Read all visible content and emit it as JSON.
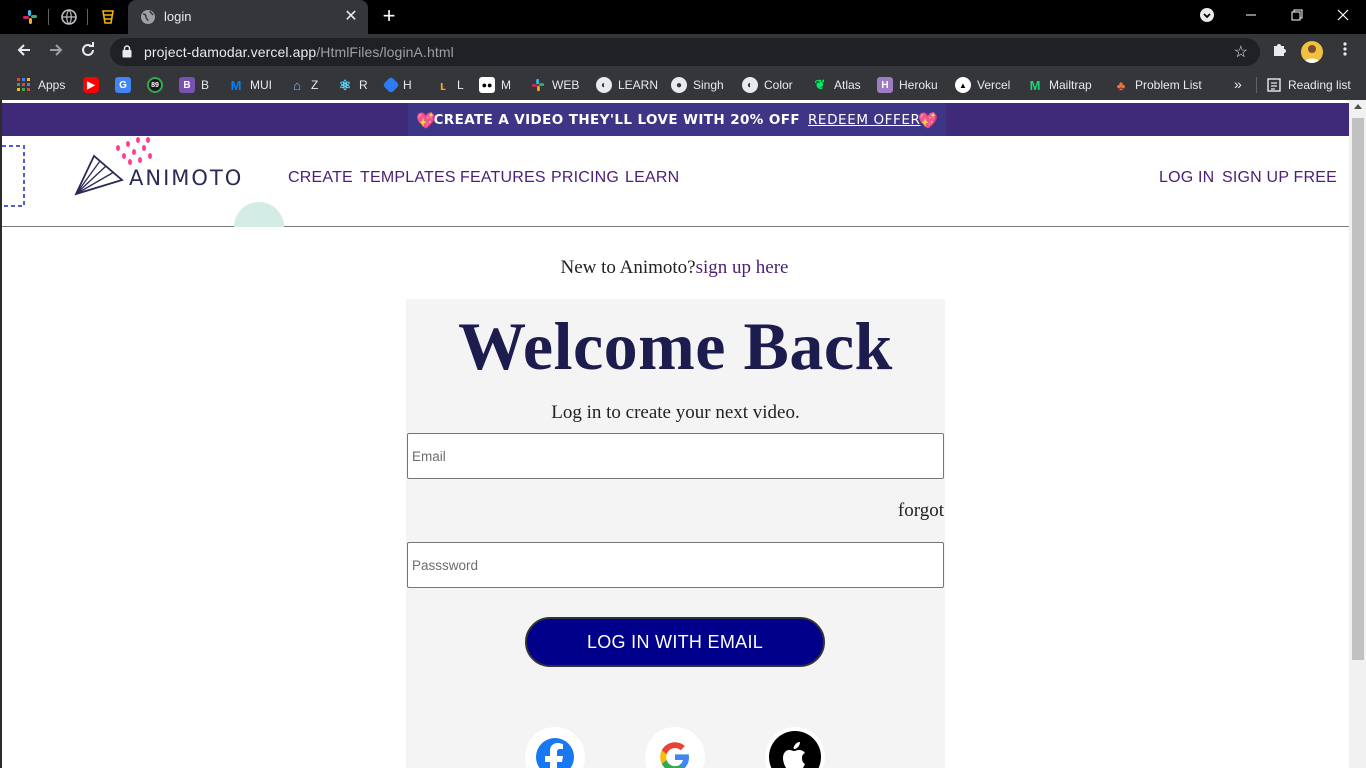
{
  "browser": {
    "tab_title": "login",
    "url_host": "project-damodar.vercel.app",
    "url_path": "/HtmlFiles/loginA.html",
    "new_tab_symbol": "+",
    "close_symbol": "✕"
  },
  "bookmarks": [
    {
      "label": "Apps",
      "icon": "apps-grid-icon",
      "color": "#ea4335"
    },
    {
      "label": "",
      "icon": "youtube-icon",
      "color": "#ff0000"
    },
    {
      "label": "",
      "icon": "google-translate-icon",
      "color": "#4285f4"
    },
    {
      "label": "",
      "icon": "badge-icon",
      "color": "#34a853"
    },
    {
      "label": "B",
      "icon": "bootstrap-icon",
      "color": "#7952b3"
    },
    {
      "label": "MUI",
      "icon": "mui-icon",
      "color": "#007fff"
    },
    {
      "label": "Z",
      "icon": "zomato-icon",
      "color": "#8ab4f8"
    },
    {
      "label": "R",
      "icon": "react-icon",
      "color": "#61dafb"
    },
    {
      "label": "H",
      "icon": "hackerrank-icon",
      "color": "#2e7bf6"
    },
    {
      "label": "L",
      "icon": "leetcode-icon",
      "color": "#ffa116"
    },
    {
      "label": "M",
      "icon": "medium-icon",
      "color": "#ffffff"
    },
    {
      "label": "WEB",
      "icon": "slack-icon",
      "color": "#e01e5a"
    },
    {
      "label": "LEARN",
      "icon": "globe-icon",
      "color": "#e8eaed"
    },
    {
      "label": "Singh",
      "icon": "github-icon",
      "color": "#e8eaed"
    },
    {
      "label": "Color",
      "icon": "globe-icon",
      "color": "#e8eaed"
    },
    {
      "label": "Atlas",
      "icon": "mongodb-icon",
      "color": "#00ed64"
    },
    {
      "label": "Heroku",
      "icon": "heroku-icon",
      "color": "#9e7cc1"
    },
    {
      "label": "Vercel",
      "icon": "vercel-icon",
      "color": "#ffffff"
    },
    {
      "label": "Mailtrap",
      "icon": "mailtrap-icon",
      "color": "#22d172"
    },
    {
      "label": "Problem List",
      "icon": "problem-list-icon",
      "color": "#ff6b35"
    }
  ],
  "bookmarks_more": "»",
  "reading_list": "Reading list",
  "promo": {
    "text": "CREATE A VIDEO THEY'LL LOVE WITH 20% OFF",
    "link": "REDEEM OFFER"
  },
  "header": {
    "logo_text": "ANIMOTO",
    "nav": [
      "CREATE",
      "TEMPLATES",
      "FEATURES",
      "PRICING",
      "LEARN"
    ],
    "login": "LOG IN",
    "signup": "SIGN UP FREE"
  },
  "login": {
    "new_text": "New to Animoto?",
    "signup_link": "sign up here",
    "title": "Welcome Back",
    "subtitle": "Log in to create your next video.",
    "email_placeholder": "Email",
    "forgot": "forgot",
    "password_placeholder": "Passsword",
    "button": "LOG IN WITH EMAIL"
  },
  "colors": {
    "brand_purple": "#4b1e77",
    "button_blue": "#00008b",
    "promo_bg": "#3f2a7a"
  }
}
